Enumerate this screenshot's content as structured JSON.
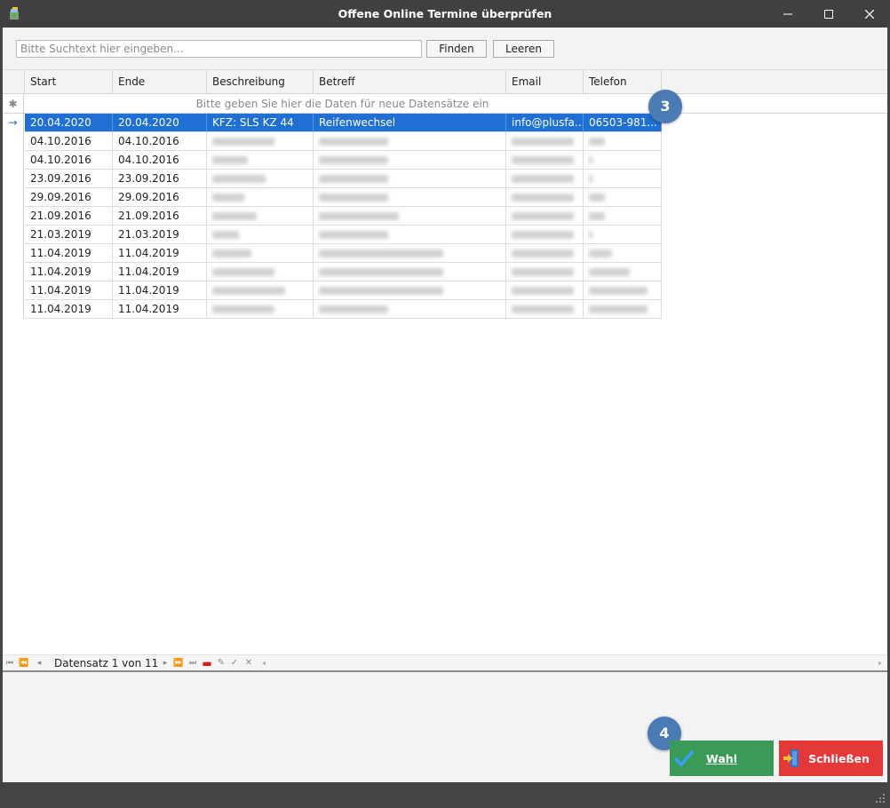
{
  "window": {
    "title": "Offene Online Termine überprüfen"
  },
  "search": {
    "placeholder": "Bitte Suchtext hier eingeben...",
    "value": "",
    "find_label": "Finden",
    "clear_label": "Leeren"
  },
  "grid": {
    "columns": [
      "Start",
      "Ende",
      "Beschreibung",
      "Betreff",
      "Email",
      "Telefon"
    ],
    "new_row_hint": "Bitte geben Sie hier die Daten  für neue Datensätze ein",
    "rows": [
      {
        "start": "20.04.2020",
        "end": "20.04.2020",
        "description": "KFZ: SLS KZ 44",
        "subject": "Reifenwechsel",
        "email": "info@plusfa...",
        "phone": "06503-981..."
      },
      {
        "start": "04.10.2016",
        "end": "04.10.2016"
      },
      {
        "start": "04.10.2016",
        "end": "04.10.2016"
      },
      {
        "start": "23.09.2016",
        "end": "23.09.2016"
      },
      {
        "start": "29.09.2016",
        "end": "29.09.2016"
      },
      {
        "start": "21.09.2016",
        "end": "21.09.2016"
      },
      {
        "start": "21.03.2019",
        "end": "21.03.2019"
      },
      {
        "start": "11.04.2019",
        "end": "11.04.2019"
      },
      {
        "start": "11.04.2019",
        "end": "11.04.2019"
      },
      {
        "start": "11.04.2019",
        "end": "11.04.2019"
      },
      {
        "start": "11.04.2019",
        "end": "11.04.2019"
      }
    ]
  },
  "navigator": {
    "record_text": "Datensatz 1 von 11"
  },
  "badges": {
    "grid_step": "3",
    "button_step": "4"
  },
  "actions": {
    "select_label": "Wahl",
    "close_label": "Schließen"
  },
  "colors": {
    "selection": "#1f6fd4",
    "select_button": "#3a9b57",
    "close_button": "#e53939",
    "badge": "#4a7bb5"
  }
}
